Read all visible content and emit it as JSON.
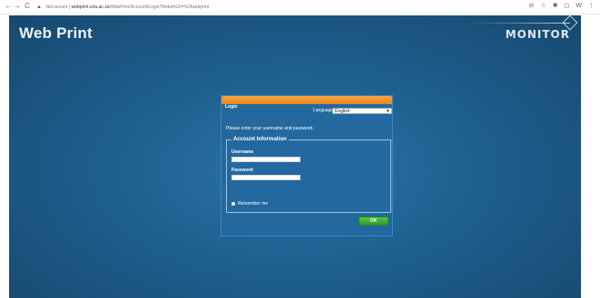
{
  "browser": {
    "back_glyph": "←",
    "forward_glyph": "→",
    "reload_glyph": "C",
    "security_label": "Not secure",
    "url_host": "webprint.edu.ac.za",
    "url_path": "/WebPrint/Account/Login?ReturnUrl=%2fwebprint",
    "ext_icons": [
      "⊘",
      "☆",
      "✱",
      "◻",
      "W",
      "⋮"
    ]
  },
  "app": {
    "title": "Web Print",
    "brand": "MONITOR"
  },
  "login": {
    "header": "Login",
    "language_label": "Language",
    "language_value": "English",
    "intro": "Please enter your username and password.",
    "fieldset_legend": "Account Information",
    "username_label": "Username",
    "username_value": "",
    "password_label": "Password",
    "password_value": "",
    "remember_label": "Remember me",
    "remember_checked": false,
    "submit_label": "OK"
  },
  "colors": {
    "background": "#1f5f8f",
    "panel": "#2468a0",
    "header_accent": "#f39530",
    "ok_button": "#3aa92c"
  }
}
